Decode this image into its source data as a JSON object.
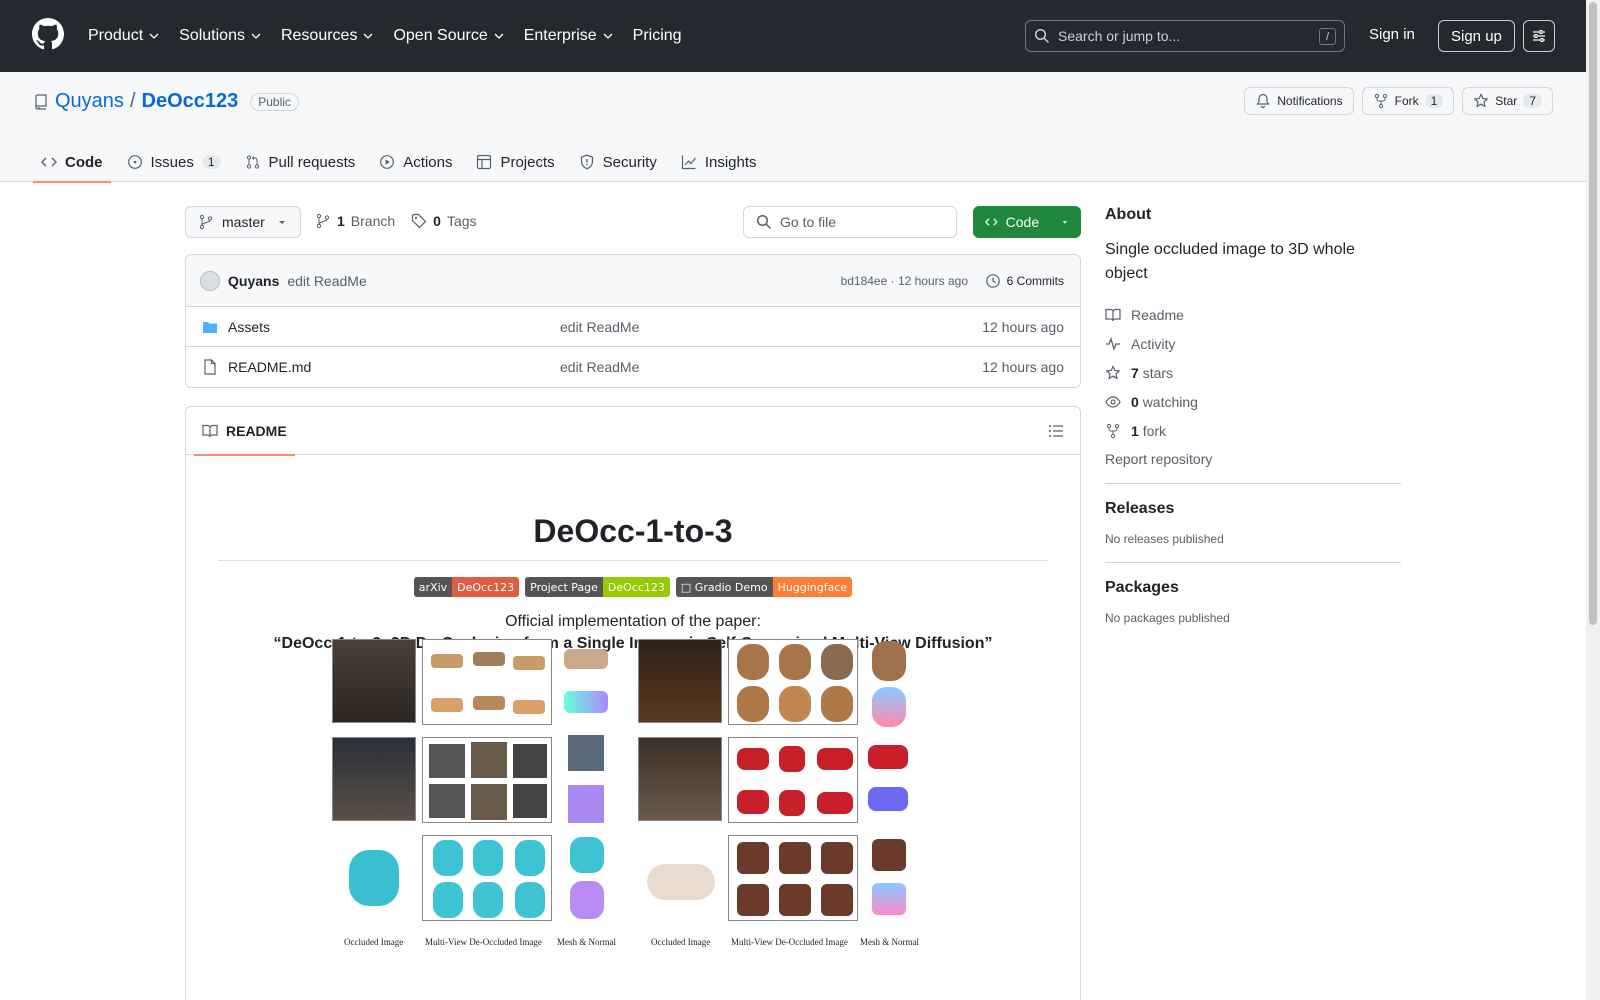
{
  "header": {
    "nav": [
      "Product",
      "Solutions",
      "Resources",
      "Open Source",
      "Enterprise",
      "Pricing"
    ],
    "search_placeholder": "Search or jump to...",
    "search_key": "/",
    "signin": "Sign in",
    "signup": "Sign up"
  },
  "repo": {
    "owner": "Quyans",
    "sep": "/",
    "name": "DeOcc123",
    "visibility": "Public",
    "notifications": "Notifications",
    "fork_label": "Fork",
    "fork_count": "1",
    "star_label": "Star",
    "star_count": "7"
  },
  "tabs": [
    {
      "label": "Code"
    },
    {
      "label": "Issues",
      "count": "1"
    },
    {
      "label": "Pull requests"
    },
    {
      "label": "Actions"
    },
    {
      "label": "Projects"
    },
    {
      "label": "Security"
    },
    {
      "label": "Insights"
    }
  ],
  "toolbar": {
    "branch": "master",
    "branch_count": "1",
    "branch_word": "Branch",
    "tag_count": "0",
    "tag_word": "Tags",
    "goto_placeholder": "Go to file",
    "code_btn": "Code"
  },
  "commit": {
    "author": "Quyans",
    "message": "edit ReadMe",
    "meta": "bd184ee · 12 hours ago",
    "commits": "6 Commits"
  },
  "files": [
    {
      "name": "Assets",
      "type": "folder",
      "message": "edit ReadMe",
      "time": "12 hours ago"
    },
    {
      "name": "README.md",
      "type": "file",
      "message": "edit ReadMe",
      "time": "12 hours ago"
    }
  ],
  "readme": {
    "tab": "README",
    "title": "DeOcc-1-to-3",
    "badges": [
      {
        "left": "arXiv",
        "right": "DeOcc123",
        "color": "#e05d44"
      },
      {
        "left": "Project Page",
        "right": "DeOcc123",
        "color": "#97ca00"
      },
      {
        "left": "□ Gradio Demo",
        "right": "Huggingface",
        "color": "#fe7d37"
      }
    ],
    "official": "Official implementation of the paper:",
    "paper": "“DeOcc-1-to-3: 3D De-Occlusion from a Single Image via Self-Supervised Multi-View Diffusion”",
    "captions": [
      "Occluded Image",
      "Multi-View De-Occluded Image",
      "Mesh & Normal",
      "Occluded Image",
      "Multi-View De-Occluded Image",
      "Mesh & Normal"
    ]
  },
  "sidebar": {
    "about": "About",
    "description": "Single occluded image to 3D whole object",
    "links": [
      {
        "icon": "book-icon",
        "label": "Readme"
      },
      {
        "icon": "pulse-icon",
        "label": "Activity"
      },
      {
        "icon": "star-icon",
        "count": "7",
        "label": "stars"
      },
      {
        "icon": "eye-icon",
        "count": "0",
        "label": "watching"
      },
      {
        "icon": "fork-icon",
        "count": "1",
        "label": "fork"
      }
    ],
    "report": "Report repository",
    "releases": "Releases",
    "releases_empty": "No releases published",
    "packages": "Packages",
    "packages_empty": "No packages published"
  },
  "colors": {
    "header_bg": "#24292f",
    "link": "#0969da",
    "code_button": "#1f883d",
    "active_tab": "#fd8c73"
  }
}
